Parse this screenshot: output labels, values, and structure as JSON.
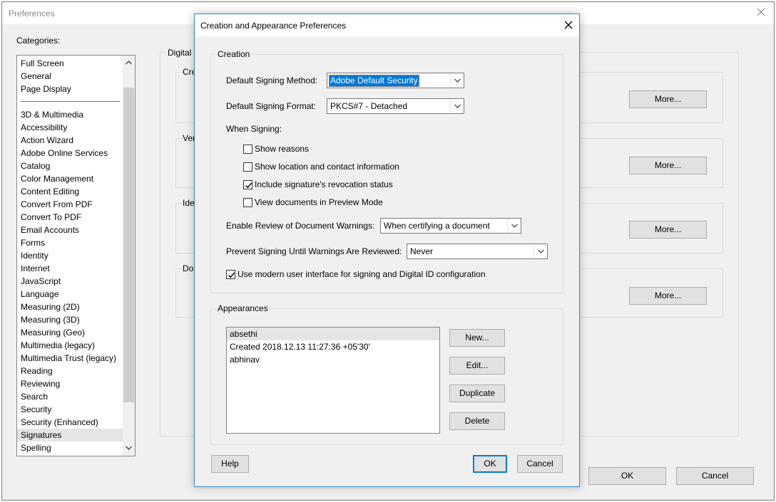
{
  "preferences": {
    "title": "Preferences",
    "categories_label": "Categories:",
    "categories_top": [
      "Full Screen",
      "General",
      "Page Display"
    ],
    "categories": [
      "3D & Multimedia",
      "Accessibility",
      "Action Wizard",
      "Adobe Online Services",
      "Catalog",
      "Color Management",
      "Content Editing",
      "Convert From PDF",
      "Convert To PDF",
      "Email Accounts",
      "Forms",
      "Identity",
      "Internet",
      "JavaScript",
      "Language",
      "Measuring (2D)",
      "Measuring (3D)",
      "Measuring (Geo)",
      "Multimedia (legacy)",
      "Multimedia Trust (legacy)",
      "Reading",
      "Reviewing",
      "Search",
      "Security",
      "Security (Enhanced)",
      "Signatures",
      "Spelling"
    ],
    "selected_category": "Signatures",
    "digital_label": "Digital",
    "groups": [
      {
        "label": "Cre",
        "more": "More..."
      },
      {
        "label": "Ver",
        "more": "More..."
      },
      {
        "label": "Ide",
        "more": "More..."
      },
      {
        "label": "Do",
        "more": "More..."
      }
    ],
    "ok_label": "OK",
    "cancel_label": "Cancel"
  },
  "dialog": {
    "title": "Creation and Appearance Preferences",
    "creation": {
      "group_label": "Creation",
      "signing_method_label": "Default Signing Method:",
      "signing_method_value": "Adobe Default Security",
      "signing_format_label": "Default Signing Format:",
      "signing_format_value": "PKCS#7 - Detached",
      "when_signing_label": "When Signing:",
      "checkboxes": [
        {
          "label": "Show reasons",
          "checked": false
        },
        {
          "label": "Show location and contact information",
          "checked": false
        },
        {
          "label": "Include signature's revocation status",
          "checked": true
        },
        {
          "label": "View documents in Preview Mode",
          "checked": false
        }
      ],
      "review_warnings_label": "Enable Review of Document Warnings:",
      "review_warnings_value": "When certifying a document",
      "prevent_signing_label": "Prevent Signing Until Warnings Are Reviewed:",
      "prevent_signing_value": "Never",
      "modern_ui_label": "Use modern user interface for signing and Digital ID configuration",
      "modern_ui_checked": true
    },
    "appearances": {
      "group_label": "Appearances",
      "items": [
        "absethi",
        "Created 2018.12.13 11:27:36 +05'30'",
        "abhinav"
      ],
      "new_label": "New...",
      "edit_label": "Edit...",
      "duplicate_label": "Duplicate",
      "delete_label": "Delete"
    },
    "help_label": "Help",
    "ok_label": "OK",
    "cancel_label": "Cancel"
  }
}
